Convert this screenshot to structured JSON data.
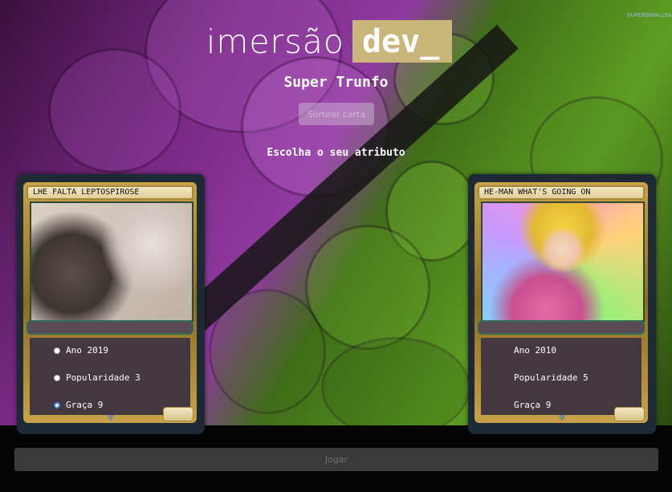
{
  "header": {
    "logo_text": "imersão",
    "logo_highlight": "dev_",
    "corner_logo": "SUPERBWALLPAPERS",
    "title": "Super Trunfo",
    "draw_button": "Sortear carta",
    "subtitle": "Escolha o seu atributo"
  },
  "player_card": {
    "name": "LHE FALTA LEPTOSPIROSE",
    "attributes": [
      {
        "label": "Ano 2019",
        "selected": false
      },
      {
        "label": "Popularidade 3",
        "selected": false
      },
      {
        "label": "Graça 9",
        "selected": true
      }
    ]
  },
  "machine_card": {
    "name": "HE-MAN WHAT'S GOING ON",
    "attributes": [
      {
        "label": "Ano 2010"
      },
      {
        "label": "Popularidade 5"
      },
      {
        "label": "Graça 9"
      }
    ]
  },
  "play_button": "Jogar",
  "colors": {
    "logo_box": "#c8b67a",
    "card_bg": "#1d2a36",
    "play_button_bg": "#3a3a3a"
  }
}
